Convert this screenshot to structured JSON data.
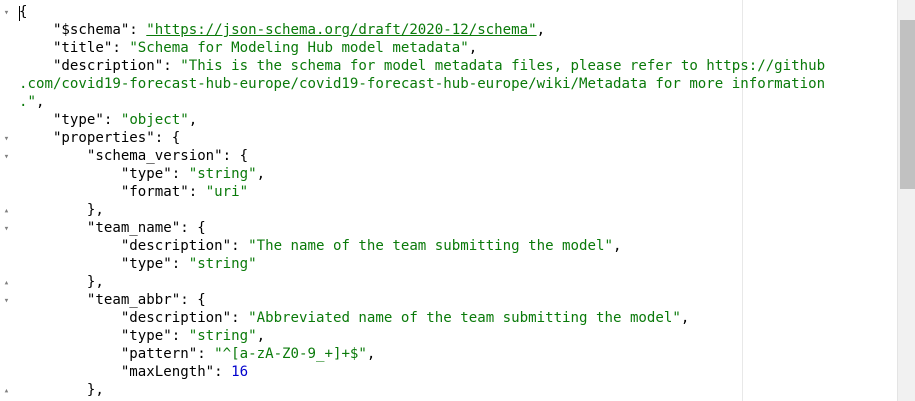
{
  "lines": [
    {
      "parts": [
        [
          "k",
          "{"
        ]
      ]
    },
    {
      "parts": [
        [
          "k",
          "    \"$schema\": "
        ],
        [
          "u",
          "\"https://json-schema.org/draft/2020-12/schema\""
        ],
        [
          "k",
          ","
        ]
      ]
    },
    {
      "parts": [
        [
          "k",
          "    \"title\": "
        ],
        [
          "s",
          "\"Schema for Modeling Hub model metadata\""
        ],
        [
          "k",
          ","
        ]
      ]
    },
    {
      "parts": [
        [
          "k",
          "    \"description\": "
        ],
        [
          "s",
          "\"This is the schema for model metadata files, please refer to https://github"
        ]
      ]
    },
    {
      "parts": [
        [
          "s",
          ".com/covid19-forecast-hub-europe/covid19-forecast-hub-europe/wiki/Metadata for more information"
        ]
      ]
    },
    {
      "parts": [
        [
          "s",
          ".\""
        ],
        [
          "k",
          ","
        ]
      ]
    },
    {
      "parts": [
        [
          "k",
          "    \"type\": "
        ],
        [
          "s",
          "\"object\""
        ],
        [
          "k",
          ","
        ]
      ]
    },
    {
      "parts": [
        [
          "k",
          "    \"properties\": {"
        ]
      ]
    },
    {
      "parts": [
        [
          "k",
          "        \"schema_version\": {"
        ]
      ]
    },
    {
      "parts": [
        [
          "k",
          "            \"type\": "
        ],
        [
          "s",
          "\"string\""
        ],
        [
          "k",
          ","
        ]
      ]
    },
    {
      "parts": [
        [
          "k",
          "            \"format\": "
        ],
        [
          "s",
          "\"uri\""
        ]
      ]
    },
    {
      "parts": [
        [
          "k",
          "        },"
        ]
      ]
    },
    {
      "parts": [
        [
          "k",
          "        \"team_name\": {"
        ]
      ]
    },
    {
      "parts": [
        [
          "k",
          "            \"description\": "
        ],
        [
          "s",
          "\"The name of the team submitting the model\""
        ],
        [
          "k",
          ","
        ]
      ]
    },
    {
      "parts": [
        [
          "k",
          "            \"type\": "
        ],
        [
          "s",
          "\"string\""
        ]
      ]
    },
    {
      "parts": [
        [
          "k",
          "        },"
        ]
      ]
    },
    {
      "parts": [
        [
          "k",
          "        \"team_abbr\": {"
        ]
      ]
    },
    {
      "parts": [
        [
          "k",
          "            \"description\": "
        ],
        [
          "s",
          "\"Abbreviated name of the team submitting the model\""
        ],
        [
          "k",
          ","
        ]
      ]
    },
    {
      "parts": [
        [
          "k",
          "            \"type\": "
        ],
        [
          "s",
          "\"string\""
        ],
        [
          "k",
          ","
        ]
      ]
    },
    {
      "parts": [
        [
          "k",
          "            \"pattern\": "
        ],
        [
          "s",
          "\"^[a-zA-Z0-9_+]+$\""
        ],
        [
          "k",
          ","
        ]
      ]
    },
    {
      "parts": [
        [
          "k",
          "            \"maxLength\": "
        ],
        [
          "n",
          "16"
        ]
      ]
    },
    {
      "parts": [
        [
          "k",
          "        },"
        ]
      ]
    }
  ],
  "fold_markers": [
    {
      "line": 0,
      "glyph": "▾"
    },
    {
      "line": 7,
      "glyph": "▾"
    },
    {
      "line": 8,
      "glyph": "▾"
    },
    {
      "line": 11,
      "glyph": "▴"
    },
    {
      "line": 12,
      "glyph": "▾"
    },
    {
      "line": 15,
      "glyph": "▴"
    },
    {
      "line": 16,
      "glyph": "▾"
    },
    {
      "line": 21,
      "glyph": "▴"
    }
  ],
  "icons": {
    "fold_open": "chevron-down-icon",
    "fold_close": "chevron-up-icon"
  }
}
